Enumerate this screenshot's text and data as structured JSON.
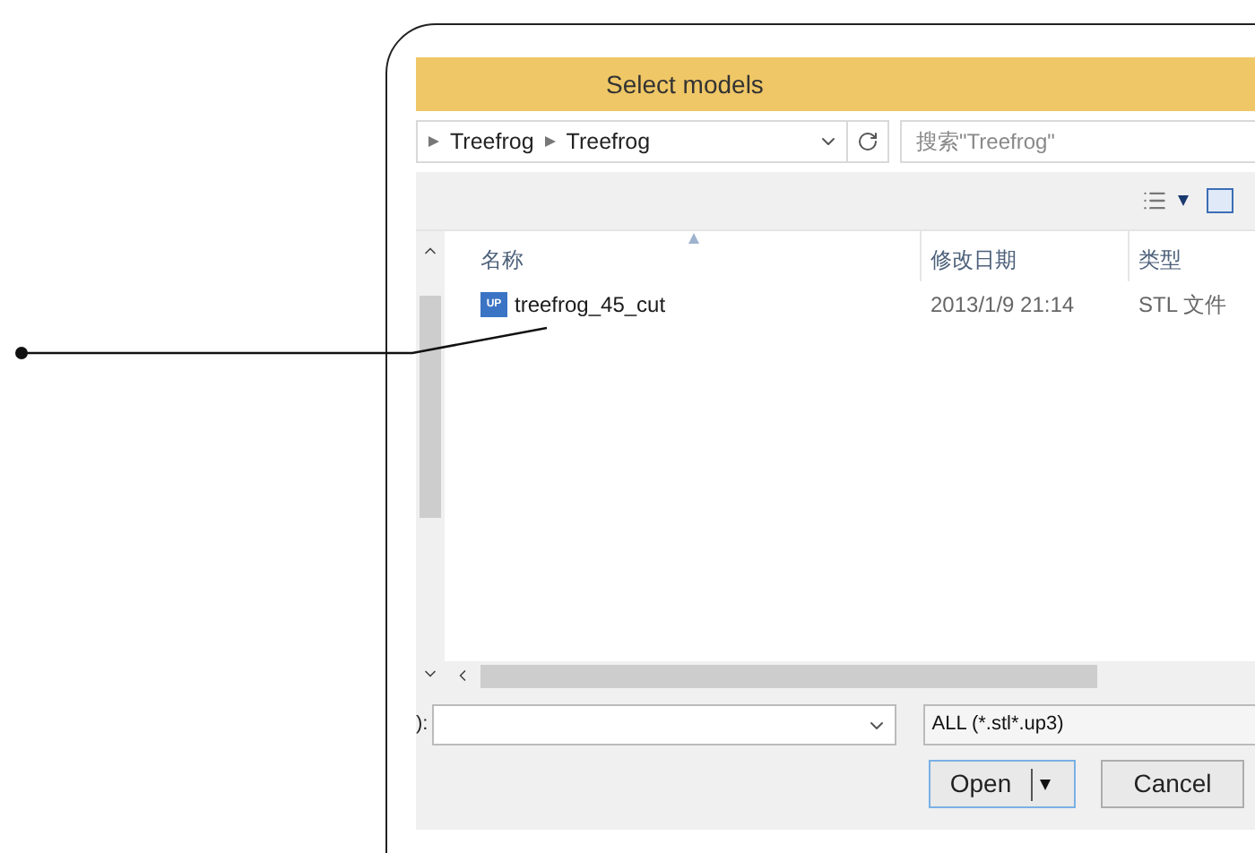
{
  "window": {
    "title": "Select models"
  },
  "address_bar": {
    "path": [
      "Treefrog",
      "Treefrog"
    ]
  },
  "search": {
    "placeholder": "搜索\"Treefrog\""
  },
  "table": {
    "columns": [
      "名称",
      "修改日期",
      "类型"
    ],
    "rows": [
      {
        "name": "treefrog_45_cut",
        "icon_label": "UP",
        "modified": "2013/1/9 21:14",
        "type": "STL 文件"
      }
    ]
  },
  "filename": {
    "label": "):"
  },
  "filter": {
    "value": "ALL (*.stl*.up3)"
  },
  "buttons": {
    "open": "Open",
    "cancel": "Cancel"
  }
}
